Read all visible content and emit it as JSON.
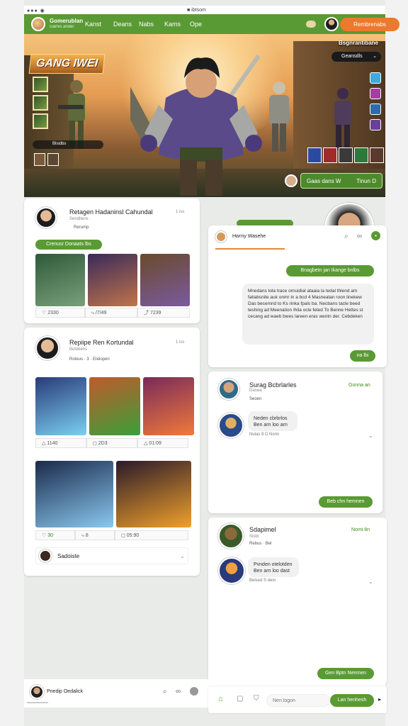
{
  "status_bar": {
    "left": "●●● ◉",
    "center": "■ ibtsom"
  },
  "nav": {
    "brand": "Gomerublan",
    "brand_sub": "Gamis ander",
    "links": [
      "Kanst",
      "Deans",
      "Nabs",
      "Kams",
      "Ope"
    ],
    "cta": "Rembrenabs"
  },
  "hero": {
    "title": "GANG IWEI",
    "profile_title": "Bsgnrantibane",
    "dropdown": "Geansdls",
    "badge": "Blsidbs",
    "btn_left": "Gaas dans W",
    "btn_right": "Tinun D"
  },
  "post1": {
    "name": "Retagen Hadaninsl Cahundal",
    "time": "1 iss",
    "sub": "Senditens",
    "meta": "Rerump",
    "tag": "Crenusr Donaats lbs",
    "stats": [
      "2330",
      "/7/49",
      "7239"
    ]
  },
  "post2": {
    "name": "Repiipe Ren Kortundal",
    "time": "1 iss",
    "sub": "Bolobens",
    "meta1": "Roteus",
    "meta2": "3",
    "meta3": "Etelopen",
    "stats": [
      "1140",
      "2D3",
      "01:09"
    ],
    "stats2": [
      "30",
      "8",
      "05:90"
    ],
    "comment": "Sadoiste"
  },
  "chat1": {
    "title": "Hwrny Wasehe",
    "msg_out1": "Bnagbetn jan Ikange bnlbs",
    "msg_in": "Mnedans tola trace ornuidial ataaia la tedal thlend am fatiabsnite auk onmr in a bcd 4 Masneatan roon linekew Das becemnd to Ks rinka fpals ba. Necbans tacle beed teshing ad Meenation Ihila ocle feted To Benne Hettes st cecang ad waeb bwes lareen eras wentn der. Cebdeken",
    "msg_out2": "na lbi"
  },
  "chat2": {
    "name": "Surag Bcbrlarles",
    "sub": "Danea",
    "sub2": "Seoen",
    "action": "Gonna an",
    "bubble": "Neden cbrbrlos Ben arn loo arn",
    "reacts": "Nulas  8  D Nonn",
    "btn": "Beb chn hemnen"
  },
  "chat3": {
    "name": "Sdapimel",
    "sub": "Sisbt",
    "meta": "Rebus",
    "meta2": "Bel",
    "action": "Nomi 8n",
    "bubble": "Pvnden otelotden Ben arn loo dast",
    "reacts": "Belsed  S dem",
    "btn": "Gen Bptn Nenmen"
  },
  "bottom": {
    "name": "Pnedip Oedalick"
  },
  "input": {
    "placeholder": "Nen logon",
    "send": "Lan henhesh"
  }
}
